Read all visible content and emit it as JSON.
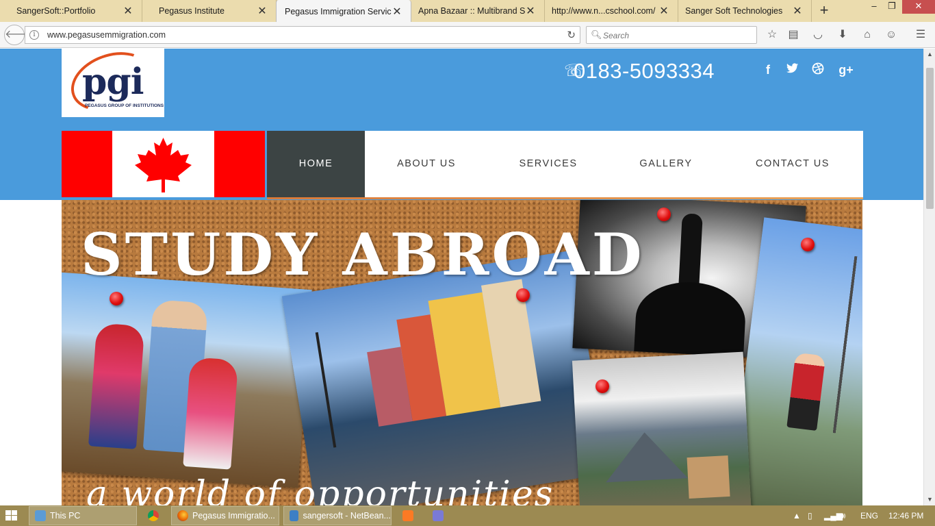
{
  "browser": {
    "tabs": [
      {
        "label": "SangerSoft::Portfolio",
        "active": false
      },
      {
        "label": "Pegasus Institute",
        "active": false
      },
      {
        "label": "Pegasus Immigration Servic...",
        "active": true
      },
      {
        "label": "Apna Bazaar :: Multibrand S...",
        "active": false
      },
      {
        "label": "http://www.n...cschool.com/",
        "active": false
      },
      {
        "label": "Sanger Soft Technologies",
        "active": false
      }
    ],
    "close_glyph": "✕",
    "new_tab_glyph": "+",
    "url": "www.pegasusemmigration.com",
    "search_placeholder": "Search",
    "window_controls": {
      "minimize": "–",
      "restore": "❐",
      "close": "✕"
    }
  },
  "site": {
    "logo_text": "pgi",
    "logo_subtitle": "PEGASUS GROUP OF INSTITUTIONS",
    "phone": "0183-5093334",
    "social": [
      "f",
      "t",
      "d",
      "g+"
    ],
    "nav": [
      {
        "label": "HOME",
        "active": true
      },
      {
        "label": "ABOUT US",
        "active": false
      },
      {
        "label": "SERVICES",
        "active": false
      },
      {
        "label": "GALLERY",
        "active": false
      },
      {
        "label": "CONTACT US",
        "active": false
      }
    ],
    "banner": {
      "title": "STUDY ABROAD",
      "subtitle": "a world of opportunities"
    },
    "colors": {
      "header": "#4a9bdc",
      "nav_active": "#3c4444",
      "flag_red": "#ff0000",
      "logo_navy": "#1c2a5a",
      "logo_orange": "#e2501d"
    }
  },
  "taskbar": {
    "items": [
      {
        "label": "This PC"
      },
      {
        "label": ""
      },
      {
        "label": "Pegasus Immigratio..."
      },
      {
        "label": "sangersoft - NetBean..."
      },
      {
        "label": ""
      },
      {
        "label": ""
      }
    ],
    "language": "ENG",
    "time": "12:46 PM"
  }
}
